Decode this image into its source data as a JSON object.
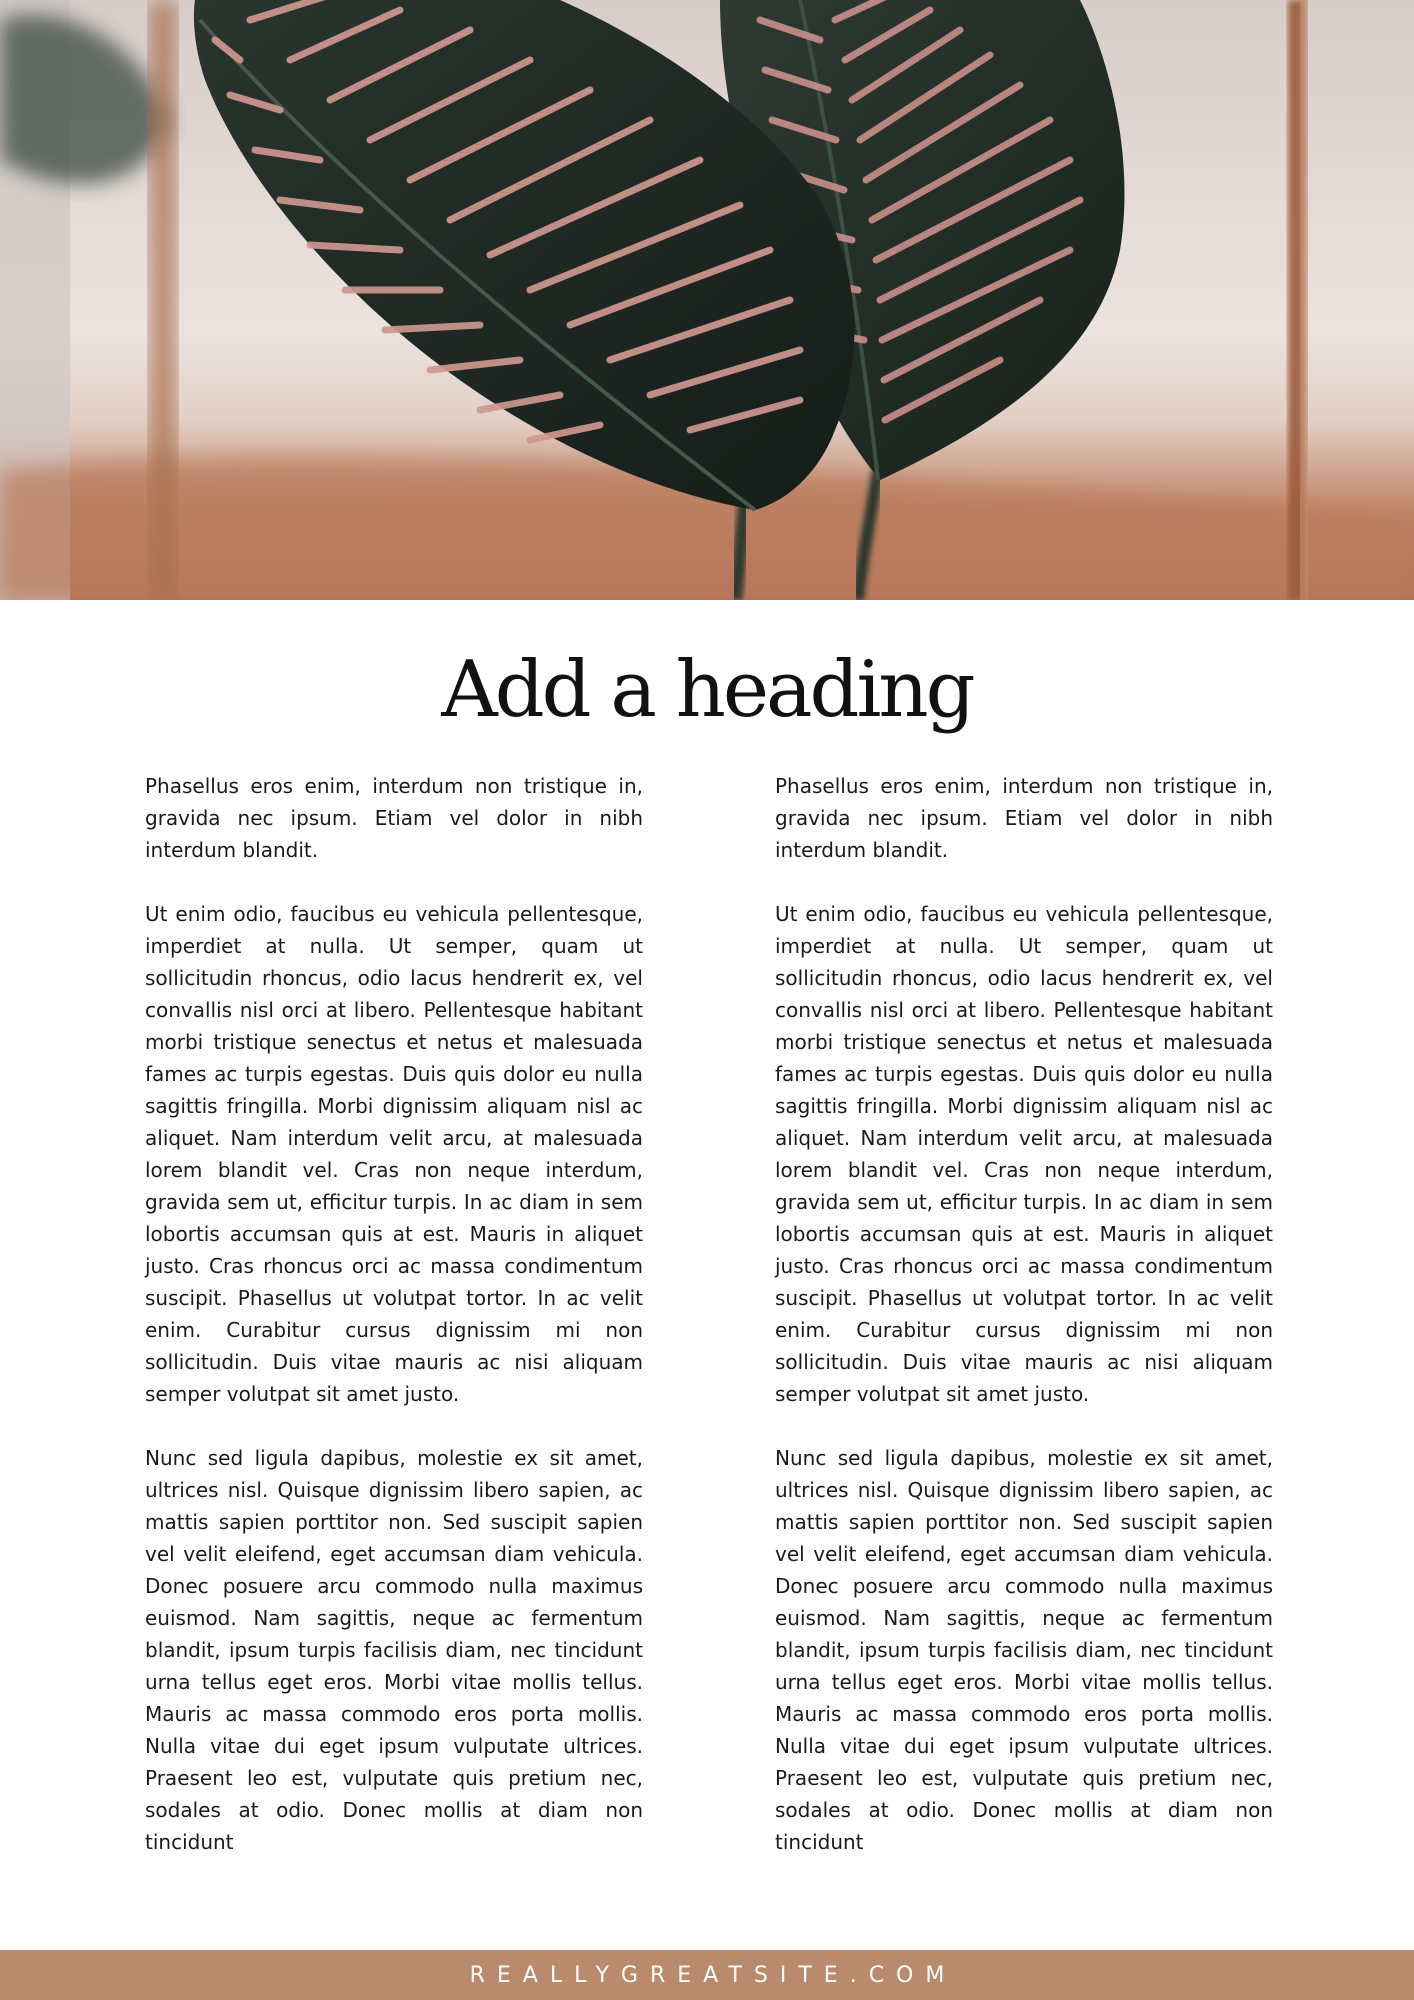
{
  "document": {
    "heading": "Add a heading",
    "columns": [
      {
        "paragraphs": [
          "Phasellus eros enim, interdum non tristique in, gravida nec ipsum. Etiam vel dolor in nibh interdum blandit.",
          "Ut enim odio, faucibus eu vehicula pellentesque, imperdiet at nulla. Ut semper, quam ut sollicitudin rhoncus, odio lacus hendrerit ex, vel convallis nisl orci at libero. Pellentesque habitant morbi tristique senectus et netus et malesuada fames ac turpis egestas. Duis quis dolor eu nulla sagittis fringilla. Morbi dignissim aliquam nisl ac aliquet. Nam interdum velit arcu, at malesuada lorem blandit vel. Cras non neque interdum, gravida sem ut, efficitur turpis. In ac diam in sem lobortis accumsan quis at est. Mauris in aliquet justo. Cras rhoncus orci ac massa condimentum suscipit. Phasellus ut volutpat tortor. In ac velit enim. Curabitur cursus dignissim mi non sollicitudin. Duis vitae mauris ac nisi aliquam semper volutpat sit amet justo.",
          "Nunc sed ligula dapibus, molestie ex sit amet, ultrices nisl. Quisque dignissim libero sapien, ac mattis sapien porttitor non. Sed suscipit sapien vel velit eleifend, eget accumsan diam vehicula. Donec posuere arcu commodo nulla maximus euismod. Nam sagittis, neque ac fermentum blandit, ipsum turpis facilisis diam, nec tincidunt urna tellus eget eros. Morbi vitae mollis tellus. Mauris ac massa commodo eros porta mollis. Nulla vitae dui eget ipsum vulputate ultrices. Praesent leo est, vulputate quis pretium nec, sodales at odio. Donec mollis at diam non tincidunt"
        ]
      },
      {
        "paragraphs": [
          "Phasellus eros enim, interdum non tristique in, gravida nec ipsum. Etiam vel dolor in nibh interdum blandit.",
          "Ut enim odio, faucibus eu vehicula pellentesque, imperdiet at nulla. Ut semper, quam ut sollicitudin rhoncus, odio lacus hendrerit ex, vel convallis nisl orci at libero. Pellentesque habitant morbi tristique senectus et netus et malesuada fames ac turpis egestas. Duis quis dolor eu nulla sagittis fringilla. Morbi dignissim aliquam nisl ac aliquet. Nam interdum velit arcu, at malesuada lorem blandit vel. Cras non neque interdum, gravida sem ut, efficitur turpis. In ac diam in sem lobortis accumsan quis at est. Mauris in aliquet justo. Cras rhoncus orci ac massa condimentum suscipit. Phasellus ut volutpat tortor. In ac velit enim. Curabitur cursus dignissim mi non sollicitudin. Duis vitae mauris ac nisi aliquam semper volutpat sit amet justo.",
          "Nunc sed ligula dapibus, molestie ex sit amet, ultrices nisl. Quisque dignissim libero sapien, ac mattis sapien porttitor non. Sed suscipit sapien vel velit eleifend, eget accumsan diam vehicula. Donec posuere arcu commodo nulla maximus euismod. Nam sagittis, neque ac fermentum blandit, ipsum turpis facilisis diam, nec tincidunt urna tellus eget eros. Morbi vitae mollis tellus. Mauris ac massa commodo eros porta mollis. Nulla vitae dui eget ipsum vulputate ultrices. Praesent leo est, vulputate quis pretium nec, sodales at odio. Donec mollis at diam non tincidunt"
        ]
      }
    ]
  },
  "footer": {
    "website": "REALLYGREATSITE.COM",
    "background_color": "#b98a6c"
  },
  "hero_image": {
    "subject": "plant-leaves-photo",
    "colors": [
      "#1f2b25",
      "#d19b93",
      "#b8775a"
    ]
  }
}
